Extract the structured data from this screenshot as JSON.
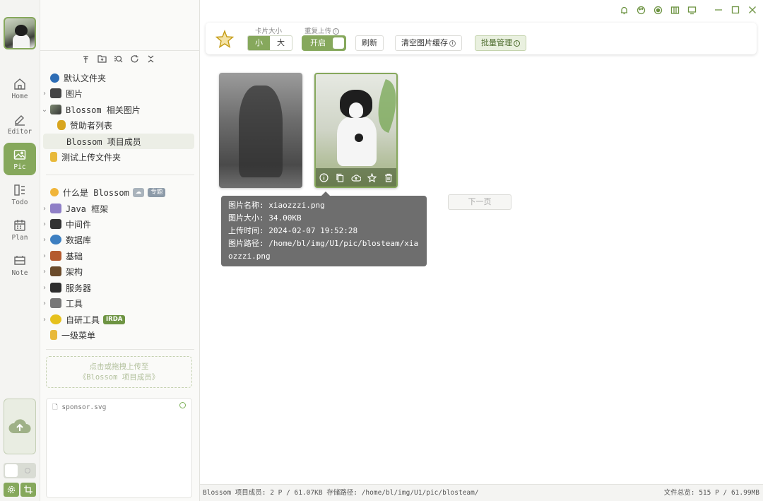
{
  "rail": {
    "items": [
      {
        "label": "Home",
        "icon": "home-icon"
      },
      {
        "label": "Editor",
        "icon": "editor-icon"
      },
      {
        "label": "Pic",
        "icon": "picture-icon"
      },
      {
        "label": "Todo",
        "icon": "todo-icon"
      },
      {
        "label": "Plan",
        "icon": "calendar-icon"
      },
      {
        "label": "Note",
        "icon": "note-icon"
      }
    ],
    "active": "Pic",
    "accent": "#86a85c"
  },
  "tree": {
    "folders": [
      {
        "label": "默认文件夹"
      },
      {
        "label": "图片"
      },
      {
        "label": "Blossom 相关图片"
      },
      {
        "label": "赞助者列表"
      },
      {
        "label": "Blossom 项目成员"
      },
      {
        "label": "测试上传文件夹"
      }
    ],
    "articles": [
      {
        "label": "什么是 Blossom",
        "badge": "专题"
      },
      {
        "label": "Java 框架"
      },
      {
        "label": "中间件"
      },
      {
        "label": "数据库"
      },
      {
        "label": "基础"
      },
      {
        "label": "架构"
      },
      {
        "label": "服务器"
      },
      {
        "label": "工具"
      },
      {
        "label": "自研工具",
        "badge": "IRDA"
      },
      {
        "label": "一级菜单"
      }
    ],
    "upload_hint_line1": "点击或拖拽上传至",
    "upload_hint_line2": "《Blossom 项目成员》",
    "upload_file": "sponsor.svg"
  },
  "toolbar": {
    "size_label": "卡片大小",
    "size_small": "小",
    "size_large": "大",
    "repeat_label": "重复上传",
    "repeat_state": "开启",
    "refresh": "刷新",
    "clear_cache": "清空图片缓存",
    "batch_manage": "批量管理"
  },
  "tooltip": {
    "name": "图片名称: xiaozzzi.png",
    "size": "图片大小: 34.00KB",
    "time": "上传时间: 2024-02-07 19:52:28",
    "path": "图片路径: /home/bl/img/U1/pic/blosteam/xiaozzzi.png"
  },
  "next_page": "下一页",
  "status": {
    "left": "Blossom 项目成员: 2 P / 61.07KB  存储路径: /home/bl/img/U1/pic/blosteam/",
    "right": "文件总览: 515 P / 61.99MB"
  }
}
